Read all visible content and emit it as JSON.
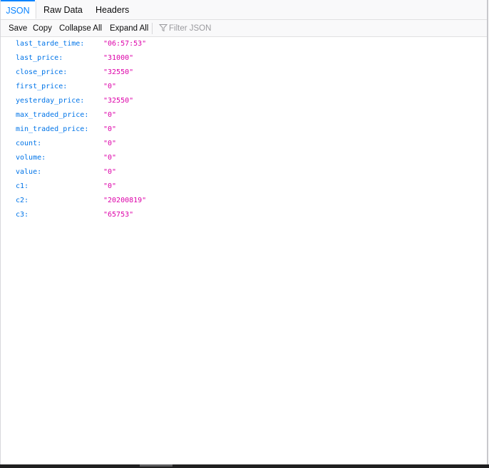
{
  "tabs": [
    {
      "label": "JSON",
      "selected": true
    },
    {
      "label": "Raw Data",
      "selected": false
    },
    {
      "label": "Headers",
      "selected": false
    }
  ],
  "toolbar": {
    "save_label": "Save",
    "copy_label": "Copy",
    "collapse_label": "Collapse All",
    "expand_label": "Expand All",
    "filter_placeholder": "Filter JSON",
    "filter_icon": "funnel-icon"
  },
  "colors": {
    "accent": "#0a84ff",
    "key": "#0074e8",
    "string_value": "#dd00a9"
  },
  "rows": [
    {
      "key": "last_tarde_time:",
      "value": "\"06:57:53\""
    },
    {
      "key": "last_price:",
      "value": "\"31000\""
    },
    {
      "key": "close_price:",
      "value": "\"32550\""
    },
    {
      "key": "first_price:",
      "value": "\"0\""
    },
    {
      "key": "yesterday_price:",
      "value": "\"32550\""
    },
    {
      "key": "max_traded_price:",
      "value": "\"0\""
    },
    {
      "key": "min_traded_price:",
      "value": "\"0\""
    },
    {
      "key": "count:",
      "value": "\"0\""
    },
    {
      "key": "volume:",
      "value": "\"0\""
    },
    {
      "key": "value:",
      "value": "\"0\""
    },
    {
      "key": "c1:",
      "value": "\"0\""
    },
    {
      "key": "c2:",
      "value": "\"20200819\""
    },
    {
      "key": "c3:",
      "value": "\"65753\""
    }
  ]
}
